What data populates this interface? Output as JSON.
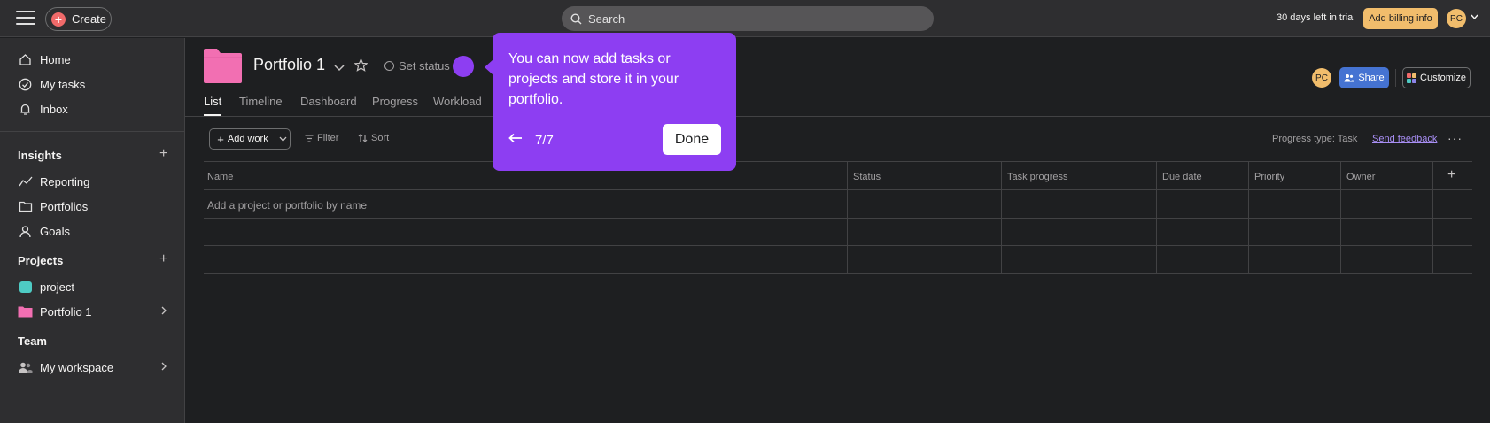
{
  "topbar": {
    "create_label": "Create",
    "search_placeholder": "Search",
    "trial_text": "30 days left in trial",
    "billing_label": "Add billing info",
    "avatar_initials": "PC"
  },
  "sidebar": {
    "nav": [
      {
        "label": "Home",
        "icon": "home-icon"
      },
      {
        "label": "My tasks",
        "icon": "check-circle-icon"
      },
      {
        "label": "Inbox",
        "icon": "bell-icon"
      }
    ],
    "insights": {
      "title": "Insights",
      "items": [
        {
          "label": "Reporting",
          "icon": "chart-line-icon"
        },
        {
          "label": "Portfolios",
          "icon": "folder-icon"
        },
        {
          "label": "Goals",
          "icon": "person-icon"
        }
      ]
    },
    "projects": {
      "title": "Projects",
      "items": [
        {
          "label": "project",
          "color": "#4ecbc4"
        },
        {
          "label": "Portfolio 1",
          "color": "#f26fb2"
        }
      ]
    },
    "team": {
      "title": "Team",
      "items": [
        {
          "label": "My workspace",
          "icon": "people-icon"
        }
      ]
    }
  },
  "header": {
    "title": "Portfolio 1",
    "set_status": "Set status",
    "avatar_initials": "PC",
    "share_label": "Share",
    "customize_label": "Customize",
    "tabs": [
      "List",
      "Timeline",
      "Dashboard",
      "Progress",
      "Workload"
    ]
  },
  "toolbar": {
    "add_work": "Add work",
    "filter": "Filter",
    "sort": "Sort",
    "progress_type": "Progress type: Task",
    "send_feedback": "Send feedback"
  },
  "table": {
    "columns": [
      "Name",
      "Status",
      "Task progress",
      "Due date",
      "Priority",
      "Owner"
    ],
    "add_row_placeholder": "Add a project or portfolio by name"
  },
  "tooltip": {
    "body": "You can now add tasks or projects and store it in your portfolio.",
    "step": "7/7",
    "done_label": "Done"
  },
  "colors": {
    "accent_purple": "#8d3ef2",
    "share_blue": "#4573d2",
    "billing_orange": "#f1bd6c",
    "portfolio_pink": "#f26fb2"
  }
}
